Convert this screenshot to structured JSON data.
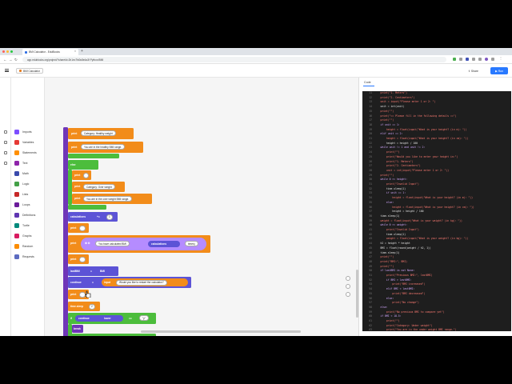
{
  "browser": {
    "tab_title": "BMI Calculator - EduBlocks",
    "tab_close": "×",
    "new_tab": "+",
    "back": "←",
    "forward": "→",
    "reload": "↻",
    "url": "app.edublocks.org/project/?shareId=2b1ec7fd0c8e4a3f  Python/BMI"
  },
  "app": {
    "project_name": "BMI Calculator",
    "share_label": "Share",
    "run_label": "Run",
    "code_tab": "Code"
  },
  "categories": [
    {
      "label": "Imports",
      "color": "#7c4dff"
    },
    {
      "label": "Variables",
      "color": "#e53935"
    },
    {
      "label": "Statements",
      "color": "#ff8f00"
    },
    {
      "label": "Text",
      "color": "#8e24aa"
    },
    {
      "label": "Math",
      "color": "#3949ab"
    },
    {
      "label": "Logic",
      "color": "#43a047"
    },
    {
      "label": "Lists",
      "color": "#c62828"
    },
    {
      "label": "Loops",
      "color": "#6a1b9a"
    },
    {
      "label": "Definitions",
      "color": "#5e35b1"
    },
    {
      "label": "Turtle",
      "color": "#00897b"
    },
    {
      "label": "Graphs",
      "color": "#d81b60"
    },
    {
      "label": "Random",
      "color": "#fb8c00"
    },
    {
      "label": "Requests",
      "color": "#5c6bc0"
    }
  ],
  "blocks": {
    "print": "print",
    "else": "else",
    "cat_healthy": "Category: Healthy weight",
    "in_healthy": "You are in the healthy BMI range.",
    "cat_over": "Category: Over weight",
    "in_over": "You are in the over weight BMI range.",
    "calculations": "calculations",
    "plus_eq": "+=",
    "num_one": "1",
    "calc_prefix": "You have calculated BMI",
    "times": "times)",
    "lastbmi": "lastBMI",
    "eq": "=",
    "bmi": "BMI",
    "continue_var": "continue",
    "input": "input",
    "restart_q": "Would you like to restart the calculator?",
    "time_sleep": "time.sleep",
    "num_two": "2",
    "if": "if",
    "lower": "lower",
    "compare": "==",
    "yes": "\"y\"",
    "break": "break"
  },
  "code": [
    {
      "n": "11",
      "t": "    print(\"1. Meters\")"
    },
    {
      "n": "12",
      "t": "    print(\"2. Centimeters\")"
    },
    {
      "n": "13",
      "t": "    unit = input(\"Please enter 1 or 2: \")"
    },
    {
      "n": "14",
      "t": "    unit = int(unit)"
    },
    {
      "n": "15",
      "t": "    print(\"\")"
    },
    {
      "n": "16",
      "t": "    print(\"== Please fill in the following details ==\")"
    },
    {
      "n": "17",
      "t": "    print(\"\")"
    },
    {
      "n": "18",
      "t": "    if unit == 1:"
    },
    {
      "n": "19",
      "t": "        height = float(input(\"What is your height? (in m): \"))"
    },
    {
      "n": "20",
      "t": "    elif unit == 2:"
    },
    {
      "n": "21",
      "t": "        height = float(input(\"What is your height? (in cm): \"))"
    },
    {
      "n": "22",
      "t": "        height = height / 100"
    },
    {
      "n": "23",
      "t": "    while unit != 1 and unit != 2:"
    },
    {
      "n": "24",
      "t": "        print(\"\")"
    },
    {
      "n": "25",
      "t": "        print(\"Would you like to enter your height in:\")"
    },
    {
      "n": "26",
      "t": "        print(\"1. Meters\")"
    },
    {
      "n": "27",
      "t": "        print(\"2. Centimeters\")"
    },
    {
      "n": "28",
      "t": "        unit = int(input(\"Please enter 1 or 2: \"))"
    },
    {
      "n": "29",
      "t": "    print(\"\")"
    },
    {
      "n": "30",
      "t": "    while 0 >= height:"
    },
    {
      "n": "31",
      "t": "        print(\"Invalid Input\")"
    },
    {
      "n": "32",
      "t": "        time.sleep(1)"
    },
    {
      "n": "33",
      "t": "        if unit == 1:"
    },
    {
      "n": "34",
      "t": "            height = float(input(\"What is your height? (in m): \"))"
    },
    {
      "n": "35",
      "t": "        else:"
    },
    {
      "n": "36",
      "t": "            height = float(input(\"What is your height? (in cm): \"))"
    },
    {
      "n": "37",
      "t": "            height = height / 100"
    },
    {
      "n": "38",
      "t": "    time.sleep(1)"
    },
    {
      "n": "39",
      "t": "    weight = float(input(\"What is your weight? (in kg): \"))"
    },
    {
      "n": "40",
      "t": "    while 0 >= weight:"
    },
    {
      "n": "41",
      "t": "        print(\"Invalid Input\")"
    },
    {
      "n": "42",
      "t": "        time.sleep(1)"
    },
    {
      "n": "43",
      "t": "        weight = float(input(\"What is your weight? (in kg): \"))"
    },
    {
      "n": "44",
      "t": "    h2 = height * height"
    },
    {
      "n": "45",
      "t": "    BMI = float(round(weight / h2, 1))"
    },
    {
      "n": "46",
      "t": "    time.sleep(1)"
    },
    {
      "n": "47",
      "t": "    print(\"\")"
    },
    {
      "n": "48",
      "t": "    print(\"BMI:\", BMI)"
    },
    {
      "n": "49",
      "t": "    print(\"\")"
    },
    {
      "n": "50",
      "t": "    if lastBMI is not None:"
    },
    {
      "n": "51",
      "t": "        print(\"Previous BMI:\", lastBMI)"
    },
    {
      "n": "52",
      "t": "        if BMI > lastBMI:"
    },
    {
      "n": "53",
      "t": "            print(\"BMI increased\")"
    },
    {
      "n": "54",
      "t": "        elif BMI < lastBMI:"
    },
    {
      "n": "55",
      "t": "            print(\"BMI decreased\")"
    },
    {
      "n": "56",
      "t": "        else:"
    },
    {
      "n": "57",
      "t": "            print(\"No change\")"
    },
    {
      "n": "58",
      "t": "    else:"
    },
    {
      "n": "59",
      "t": "        print(\"No previous BMI to compare yet\")"
    },
    {
      "n": "60",
      "t": "    if BMI < 18.5:"
    },
    {
      "n": "61",
      "t": "        print(\"\")"
    },
    {
      "n": "62",
      "t": "        print(\"Category: Under weight\")"
    },
    {
      "n": "63",
      "t": "        print(\"You are in the under weight BMI range.\")"
    },
    {
      "n": "64",
      "t": "    elif BMI < 25:"
    }
  ],
  "colors": {
    "statements": "#f28c1a",
    "variables_block": "#5c53d6",
    "logic": "#4cbd3c",
    "loop_bar": "#6f36b8",
    "text_pill": "#b58cff",
    "run": "#2979ff"
  }
}
